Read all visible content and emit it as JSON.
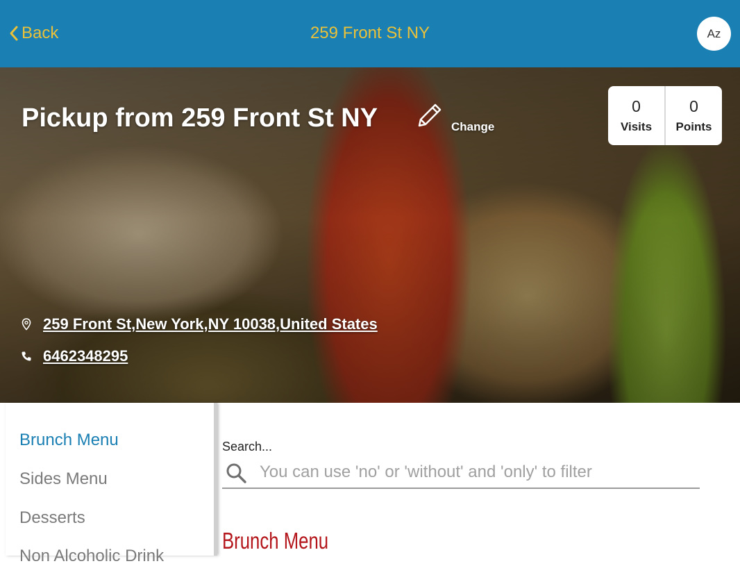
{
  "header": {
    "back_label": "Back",
    "title": "259 Front St NY",
    "avatar_text": "Az",
    "background_color": "#1a7fb2",
    "text_color": "#e9c13a"
  },
  "hero": {
    "pickup_title": "Pickup from 259 Front St NY",
    "change_label": "Change",
    "stats": [
      {
        "value": "0",
        "label": "Visits"
      },
      {
        "value": "0",
        "label": "Points"
      }
    ],
    "address": "259 Front St,New York,NY 10038,United States",
    "phone": "6462348295",
    "icons": {
      "edit": "pencil-icon",
      "location": "location-pin-icon",
      "phone": "phone-icon"
    }
  },
  "sidebar": {
    "items": [
      {
        "label": "Brunch Menu",
        "active": true
      },
      {
        "label": "Sides Menu",
        "active": false
      },
      {
        "label": "Desserts",
        "active": false
      },
      {
        "label": "Non Alcoholic Drink",
        "active": false
      }
    ],
    "active_color": "#1a7fb2"
  },
  "search": {
    "label": "Search...",
    "placeholder": "You can use 'no' or 'without' and 'only' to filter",
    "value": "",
    "icon": "search-icon"
  },
  "menu": {
    "section_title": "Brunch Menu",
    "section_color": "#b3151a"
  }
}
